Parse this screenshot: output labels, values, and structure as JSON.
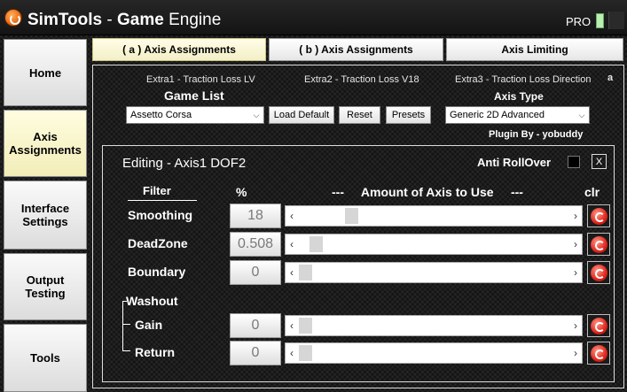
{
  "app": {
    "title_part1": "SimTools",
    "title_sep": " - ",
    "title_part2": "Game",
    "title_part3": "Engine",
    "pro_label": "PRO"
  },
  "sidebar": {
    "items": [
      {
        "label": "Home"
      },
      {
        "label": "Axis\nAssignments"
      },
      {
        "label": "Interface\nSettings"
      },
      {
        "label": "Output\nTesting"
      },
      {
        "label": "Tools"
      }
    ]
  },
  "tabs": [
    {
      "label": "( a ) Axis Assignments"
    },
    {
      "label": "( b ) Axis Assignments"
    },
    {
      "label": "Axis Limiting"
    }
  ],
  "extras": {
    "extra1": "Extra1 - Traction Loss LV",
    "extra2": "Extra2 - Traction Loss V18",
    "extra3": "Extra3 - Traction Loss Direction",
    "marker": "a"
  },
  "game_list": {
    "label": "Game List",
    "selected": "Assetto Corsa"
  },
  "buttons": {
    "load_default": "Load Default",
    "reset": "Reset",
    "presets": "Presets"
  },
  "axis_type": {
    "label": "Axis Type",
    "selected": "Generic 2D Advanced"
  },
  "plugin_by": "Plugin By - yobuddy",
  "editor": {
    "title": "Editing - Axis1 DOF2",
    "anti_rollover_label": "Anti RollOver",
    "close_label": "X",
    "col_filter": "Filter",
    "col_percent": "%",
    "col_amount": "---     Amount of Axis to Use     ---",
    "col_clr": "clr",
    "washout_label": "Washout",
    "rows": [
      {
        "label": "Smoothing",
        "value": "18",
        "fraction": 0.18
      },
      {
        "label": "DeadZone",
        "value": "0.508",
        "fraction": 0.04
      },
      {
        "label": "Boundary",
        "value": "0",
        "fraction": 0.0
      },
      {
        "label": "Gain",
        "value": "0",
        "fraction": 0.0
      },
      {
        "label": "Return",
        "value": "0",
        "fraction": 0.0
      }
    ]
  }
}
